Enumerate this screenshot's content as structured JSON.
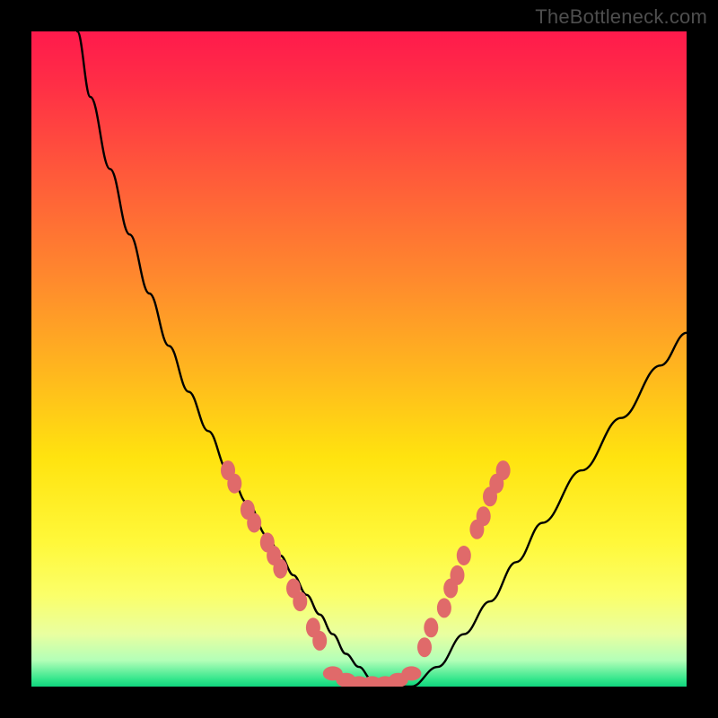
{
  "watermark": "TheBottleneck.com",
  "chart_data": {
    "type": "line",
    "title": "",
    "xlabel": "",
    "ylabel": "",
    "xlim": [
      0,
      100
    ],
    "ylim": [
      0,
      100
    ],
    "grid": false,
    "legend": false,
    "background_gradient": [
      {
        "stop": 0,
        "color": "#ff1a4c"
      },
      {
        "stop": 50,
        "color": "#ffb71e"
      },
      {
        "stop": 80,
        "color": "#fff83a"
      },
      {
        "stop": 96,
        "color": "#b3ffb8"
      },
      {
        "stop": 100,
        "color": "#11d47e"
      }
    ],
    "series": [
      {
        "name": "curve",
        "color": "#000000",
        "x": [
          7,
          9,
          12,
          15,
          18,
          21,
          24,
          27,
          30,
          33,
          36,
          38,
          40,
          42,
          44,
          46,
          48,
          50,
          52,
          54,
          58,
          62,
          66,
          70,
          74,
          78,
          84,
          90,
          96,
          100
        ],
        "y": [
          100,
          90,
          79,
          69,
          60,
          52,
          45,
          39,
          33,
          28,
          23,
          20,
          17,
          14,
          11,
          8,
          5,
          3,
          1,
          0,
          0,
          3,
          8,
          13,
          19,
          25,
          33,
          41,
          49,
          54
        ]
      }
    ],
    "markers": {
      "color": "#e06a6a",
      "left_arm": [
        {
          "x": 30,
          "y": 33
        },
        {
          "x": 31,
          "y": 31
        },
        {
          "x": 33,
          "y": 27
        },
        {
          "x": 34,
          "y": 25
        },
        {
          "x": 36,
          "y": 22
        },
        {
          "x": 37,
          "y": 20
        },
        {
          "x": 38,
          "y": 18
        },
        {
          "x": 40,
          "y": 15
        },
        {
          "x": 41,
          "y": 13
        },
        {
          "x": 43,
          "y": 9
        },
        {
          "x": 44,
          "y": 7
        }
      ],
      "valley": [
        {
          "x": 46,
          "y": 2
        },
        {
          "x": 48,
          "y": 1
        },
        {
          "x": 50,
          "y": 0.5
        },
        {
          "x": 52,
          "y": 0.5
        },
        {
          "x": 54,
          "y": 0.5
        },
        {
          "x": 56,
          "y": 1
        },
        {
          "x": 58,
          "y": 2
        }
      ],
      "right_arm": [
        {
          "x": 60,
          "y": 6
        },
        {
          "x": 61,
          "y": 9
        },
        {
          "x": 63,
          "y": 12
        },
        {
          "x": 64,
          "y": 15
        },
        {
          "x": 65,
          "y": 17
        },
        {
          "x": 66,
          "y": 20
        },
        {
          "x": 68,
          "y": 24
        },
        {
          "x": 69,
          "y": 26
        },
        {
          "x": 70,
          "y": 29
        },
        {
          "x": 71,
          "y": 31
        },
        {
          "x": 72,
          "y": 33
        }
      ]
    }
  }
}
